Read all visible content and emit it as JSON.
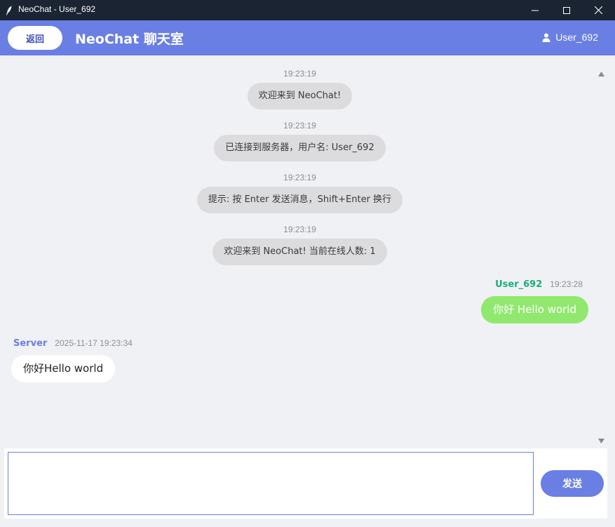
{
  "window": {
    "title": "NeoChat - User_692"
  },
  "header": {
    "back_label": "返回",
    "title": "NeoChat 聊天室",
    "username": "User_692"
  },
  "system_messages": [
    {
      "time": "19:23:19",
      "text": "欢迎来到 NeoChat!"
    },
    {
      "time": "19:23:19",
      "text": "已连接到服务器，用户名: User_692"
    },
    {
      "time": "19:23:19",
      "text": "提示: 按 Enter 发送消息，Shift+Enter 换行"
    },
    {
      "time": "19:23:19",
      "text": "欢迎来到 NeoChat! 当前在线人数: 1"
    }
  ],
  "self_message": {
    "sender": "User_692",
    "time": "19:23:28",
    "text": "你好 Hello world"
  },
  "other_message": {
    "sender": "Server",
    "time": "2025-11-17 19:23:34",
    "text": "你好Hello world"
  },
  "composer": {
    "value": "",
    "send_label": "发送"
  },
  "colors": {
    "accent": "#6a7fe3",
    "self_name": "#1aae7a",
    "self_bubble": "#90e86f",
    "other_name": "#6a7fe3",
    "system_bubble": "#dcdcdf",
    "titlebar": "#1b2433"
  },
  "icons": {
    "app": "feather-icon",
    "minimize": "minimize-icon",
    "maximize": "maximize-icon",
    "close": "close-icon",
    "user": "user-icon",
    "scroll_up": "triangle-up-icon",
    "scroll_down": "triangle-down-icon"
  }
}
